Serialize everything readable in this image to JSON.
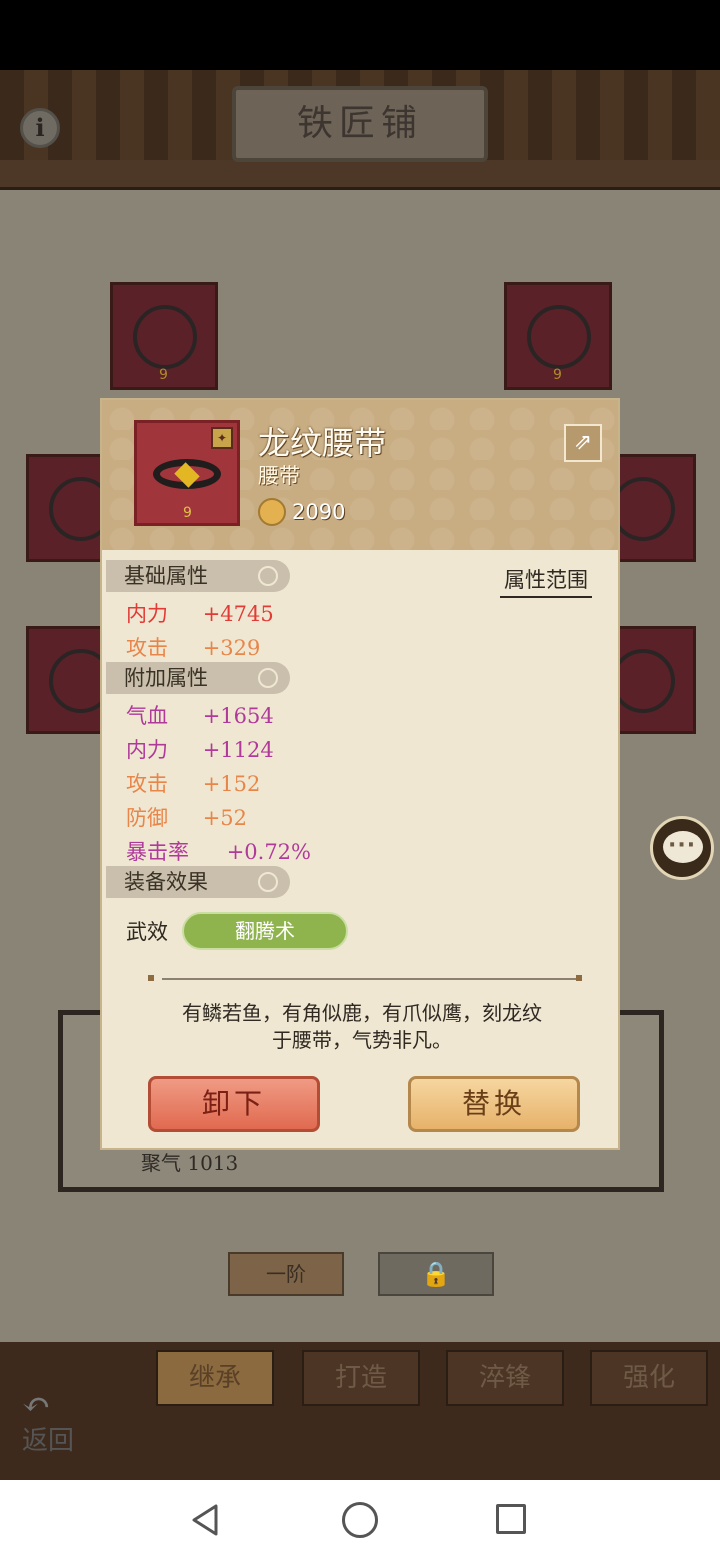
{
  "header": {
    "title": "铁匠铺"
  },
  "modal": {
    "item_name": "龙纹腰带",
    "item_type": "腰带",
    "power": "2090",
    "item_level_badge": "9",
    "item_rank_badge": "✦",
    "share_icon": "share-icon",
    "attr_range_label": "属性范围",
    "sections": {
      "base": "基础属性",
      "extra": "附加属性",
      "effect": "装备效果"
    },
    "base_stats": [
      {
        "name": "内力",
        "value": "+4745",
        "color": "#e23b36"
      },
      {
        "name": "攻击",
        "value": "+329",
        "color": "#e8864a"
      }
    ],
    "extra_stats": [
      {
        "name": "气血",
        "value": "+1654",
        "color": "#b03a9a"
      },
      {
        "name": "内力",
        "value": "+1124",
        "color": "#b03a9a"
      },
      {
        "name": "攻击",
        "value": "+152",
        "color": "#e8864a"
      },
      {
        "name": "防御",
        "value": "+52",
        "color": "#e8864a"
      },
      {
        "name": "暴击率",
        "value": "+0.72%",
        "color": "#b03a9a"
      }
    ],
    "effect_label": "武效",
    "effect_skill": "翻腾术",
    "flavor_text_line1": "有鳞若鱼，有角似鹿，有爪似鹰，刻龙纹",
    "flavor_text_line2": "于腰带，气势非凡。",
    "unequip_label": "卸下",
    "replace_label": "替换"
  },
  "background": {
    "info_label": "i",
    "partial_text": "聚气 1013",
    "tier_label": "一阶",
    "tabs": [
      "继承",
      "打造",
      "淬锋",
      "强化"
    ],
    "back_label": "返回"
  },
  "nav": {
    "back": "back-triangle-icon",
    "home": "home-circle-icon",
    "recent": "recent-square-icon"
  }
}
